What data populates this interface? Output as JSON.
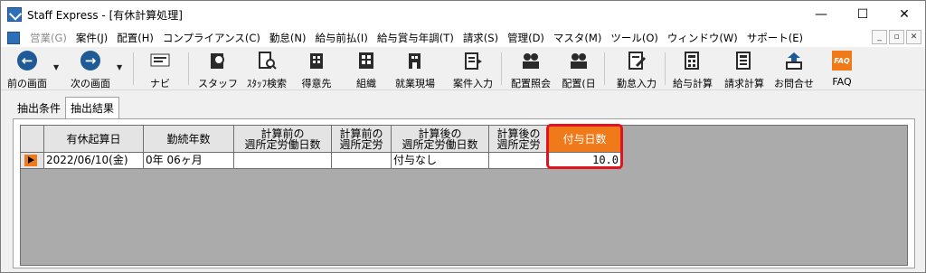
{
  "window": {
    "title": "Staff Express - [有休計算処理]",
    "controls": [
      "—",
      "☐",
      "✕"
    ]
  },
  "menu": {
    "items": [
      {
        "label": "営業(G)",
        "enabled": false
      },
      {
        "label": "案件(J)",
        "enabled": true
      },
      {
        "label": "配置(H)",
        "enabled": true
      },
      {
        "label": "コンプライアンス(C)",
        "enabled": true
      },
      {
        "label": "勤怠(N)",
        "enabled": true
      },
      {
        "label": "給与前払(I)",
        "enabled": true
      },
      {
        "label": "給与賞与年調(T)",
        "enabled": true
      },
      {
        "label": "請求(S)",
        "enabled": true
      },
      {
        "label": "管理(D)",
        "enabled": true
      },
      {
        "label": "マスタ(M)",
        "enabled": true
      },
      {
        "label": "ツール(O)",
        "enabled": true
      },
      {
        "label": "ウィンドウ(W)",
        "enabled": true
      },
      {
        "label": "サポート(E)",
        "enabled": true
      }
    ],
    "mdi_controls": [
      "_",
      "▫",
      "✕"
    ]
  },
  "toolbar": {
    "prev": "前の画面",
    "next": "次の画面",
    "navi": "ナビ",
    "staff": "スタッフ",
    "staff_search": "ｽﾀｯﾌ検索",
    "client": "得意先",
    "org": "組織",
    "site": "就業現場",
    "case_input": "案件入力",
    "assign_query": "配置照会",
    "assign_day": "配置(日",
    "attendance_input": "勤怠入力",
    "payroll": "給与計算",
    "billing": "請求計算",
    "inquiry": "お問合せ",
    "faq": "FAQ",
    "faq_icon_text": "FAQ"
  },
  "tabs": {
    "conditions": "抽出条件",
    "results": "抽出結果",
    "active": "results"
  },
  "grid": {
    "headers": {
      "start_date": "有休起算日",
      "years": "勤続年数",
      "pre_days_l1": "計算前の",
      "pre_days_l2": "週所定労働日数",
      "pre_hours_l1": "計算前の",
      "pre_hours_l2": "週所定労",
      "post_days_l1": "計算後の",
      "post_days_l2": "週所定労働日数",
      "post_hours_l1": "計算後の",
      "post_hours_l2": "週所定労",
      "grant_days": "付与日数"
    },
    "rows": [
      {
        "start_date": "2022/06/10(金)",
        "years": "0年 06ヶ月",
        "pre_days": "",
        "pre_hours": "",
        "post_days": "付与なし",
        "post_hours": "",
        "grant_days": "10.0"
      }
    ],
    "highlight_color": "#f07a1a",
    "callout_color": "#e0141e"
  }
}
